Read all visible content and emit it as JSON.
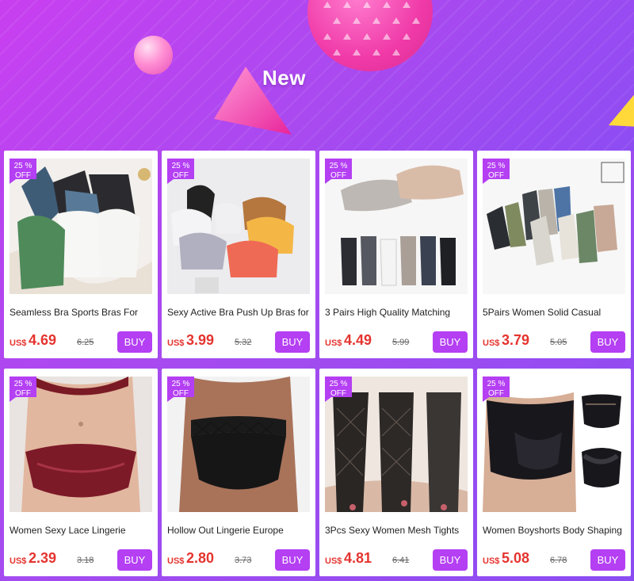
{
  "banner": {
    "title": "New"
  },
  "colors": {
    "accent": "#b43ff3",
    "price": "#e5342f",
    "badge": "#b43ff3"
  },
  "products": [
    {
      "badge_pct": "25 %",
      "badge_off": "OFF",
      "title": "Seamless Bra Sports Bras For",
      "currency": "US$",
      "price": "4.69",
      "old_price": "6.25",
      "buy": "BUY",
      "image": "bras-flatlay"
    },
    {
      "badge_pct": "25 %",
      "badge_off": "OFF",
      "title": "Sexy Active Bra Push Up Bras for",
      "currency": "US$",
      "price": "3.99",
      "old_price": "5.32",
      "buy": "BUY",
      "image": "bras-colors"
    },
    {
      "badge_pct": "25 %",
      "badge_off": "OFF",
      "title": "3 Pairs High Quality Matching",
      "currency": "US$",
      "price": "4.49",
      "old_price": "5.99",
      "buy": "BUY",
      "image": "invisible-socks"
    },
    {
      "badge_pct": "25 %",
      "badge_off": "OFF",
      "title": "5Pairs Women Solid Casual",
      "currency": "US$",
      "price": "3.79",
      "old_price": "5.05",
      "buy": "BUY",
      "image": "ankle-socks"
    },
    {
      "badge_pct": "25 %",
      "badge_off": "OFF",
      "title": "Women Sexy Lace Lingerie",
      "currency": "US$",
      "price": "2.39",
      "old_price": "3.18",
      "buy": "BUY",
      "image": "lace-panty"
    },
    {
      "badge_pct": "25 %",
      "badge_off": "OFF",
      "title": "Hollow Out Lingerie Europe",
      "currency": "US$",
      "price": "2.80",
      "old_price": "3.73",
      "buy": "BUY",
      "image": "fishnet-panty"
    },
    {
      "badge_pct": "25 %",
      "badge_off": "OFF",
      "title": "3Pcs Sexy Women Mesh Tights",
      "currency": "US$",
      "price": "4.81",
      "old_price": "6.41",
      "buy": "BUY",
      "image": "mesh-tights"
    },
    {
      "badge_pct": "25 %",
      "badge_off": "OFF",
      "title": "Women Boyshorts Body Shaping",
      "currency": "US$",
      "price": "5.08",
      "old_price": "6.78",
      "buy": "BUY",
      "image": "boyshorts"
    }
  ]
}
